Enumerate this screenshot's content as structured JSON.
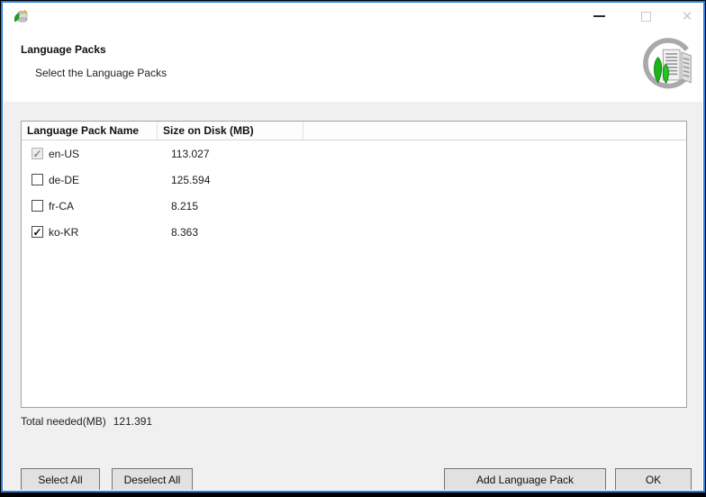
{
  "titlebar": {
    "app_icon": "language-pack-app-icon",
    "controls": {
      "minimize": "minimize",
      "maximize": "maximize",
      "close": "close"
    }
  },
  "header": {
    "title": "Language Packs",
    "subtitle": "Select the Language Packs",
    "icon": "sql-server-setup-icon"
  },
  "table": {
    "columns": [
      "Language Pack Name",
      "Size on Disk (MB)",
      ""
    ],
    "rows": [
      {
        "name": "en-US",
        "size": "113.027",
        "checked": true,
        "disabled": true
      },
      {
        "name": "de-DE",
        "size": "125.594",
        "checked": false,
        "disabled": false
      },
      {
        "name": "fr-CA",
        "size": "8.215",
        "checked": false,
        "disabled": false
      },
      {
        "name": "ko-KR",
        "size": "8.363",
        "checked": true,
        "disabled": false
      }
    ]
  },
  "summary": {
    "label": "Total needed(MB)",
    "value": "121.391"
  },
  "buttons": {
    "select_all": "Select All",
    "deselect_all": "Deselect All",
    "add_language_pack": "Add Language Pack",
    "ok": "OK"
  },
  "colors": {
    "accent_border": "#2a80d5",
    "content_bg": "#f0f0f0",
    "band_bg": "#ffffff",
    "tree_green": "#1faf1f"
  }
}
